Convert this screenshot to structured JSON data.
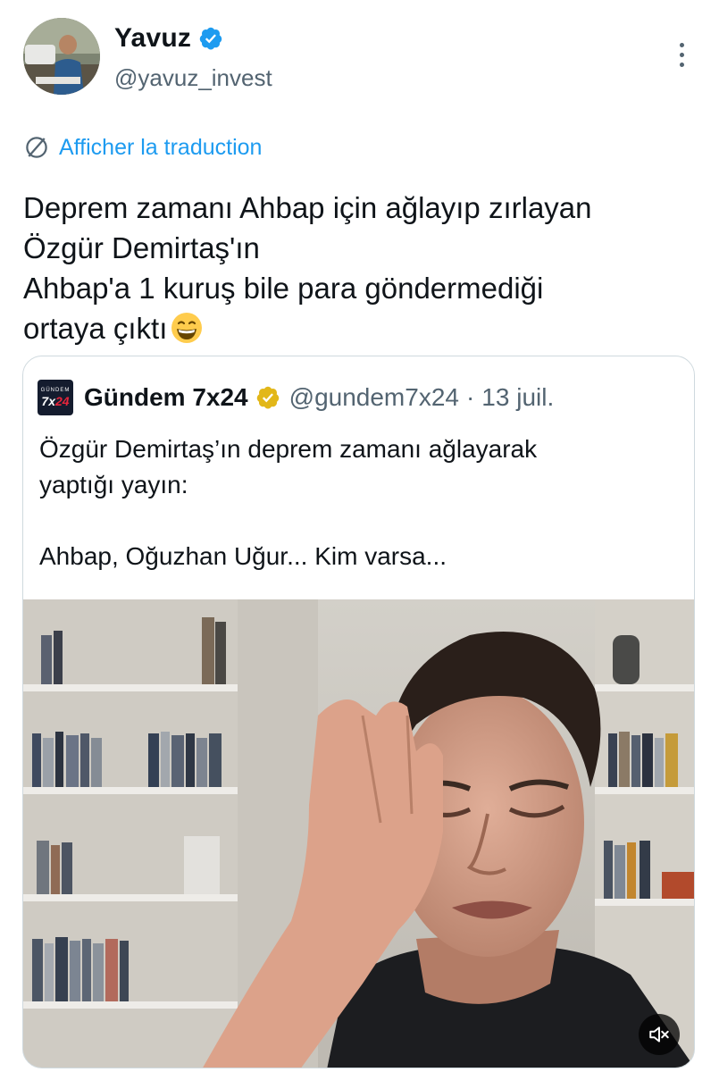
{
  "author": {
    "name": "Yavuz",
    "handle": "@yavuz_invest"
  },
  "translate_label": "Afficher la traduction",
  "tweet_text": "Deprem zamanı Ahbap için ağlayıp zırlayan\nÖzgür Demirtaş'ın\nAhbap'a 1 kuruş bile para göndermediği\nortaya çıktı",
  "quoted_tweet": {
    "logo_top": "GÜNDEM",
    "logo_bottom_a": "7x",
    "logo_bottom_b": "24",
    "name": "Gündem 7x24",
    "handle": "@gundem7x24",
    "separator": "·",
    "date": "13 juil.",
    "text": "Özgür Demirtaş’ın deprem zamanı ağlayarak\nyaptığı yayın:\n\nAhbap, Oğuzhan Uğur... Kim varsa..."
  },
  "icons": {
    "verified": "verified-badge-icon",
    "gold_verified": "gold-verified-badge-icon",
    "more": "more-options-icon",
    "translate": "globe-icon",
    "emoji": "grinning-face-emoji",
    "mute": "muted-speaker-icon"
  },
  "colors": {
    "accent": "#1d9bf0",
    "gold": "#e2b719",
    "text": "#0f1419",
    "secondary": "#536471"
  }
}
